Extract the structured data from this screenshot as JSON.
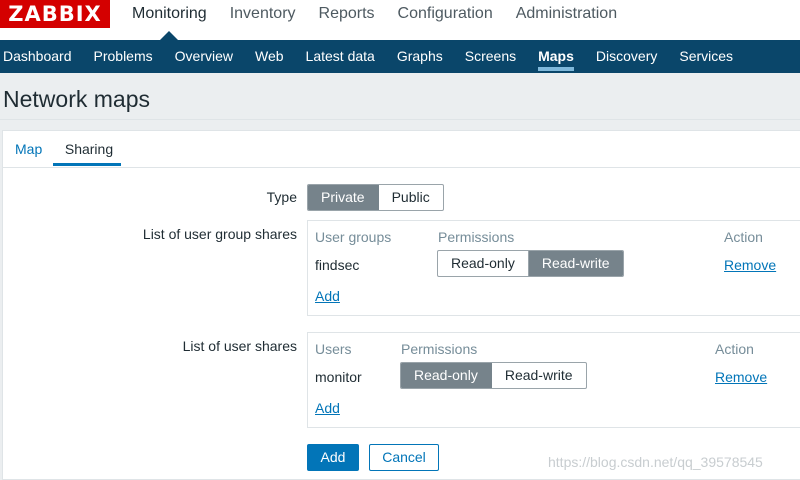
{
  "logo": "ZABBIX",
  "top_menu": [
    "Monitoring",
    "Inventory",
    "Reports",
    "Configuration",
    "Administration"
  ],
  "sub_menu": [
    "Dashboard",
    "Problems",
    "Overview",
    "Web",
    "Latest data",
    "Graphs",
    "Screens",
    "Maps",
    "Discovery",
    "Services"
  ],
  "page_title": "Network maps",
  "tabs": {
    "map": "Map",
    "sharing": "Sharing"
  },
  "type": {
    "label": "Type",
    "options": [
      "Private",
      "Public"
    ],
    "selected": "Private"
  },
  "group_shares": {
    "label": "List of user group shares",
    "headers": {
      "name": "User groups",
      "permissions": "Permissions",
      "action": "Action"
    },
    "rows": [
      {
        "name": "findsec",
        "options": [
          "Read-only",
          "Read-write"
        ],
        "selected": "Read-write",
        "action": "Remove"
      }
    ],
    "add": "Add"
  },
  "user_shares": {
    "label": "List of user shares",
    "headers": {
      "name": "Users",
      "permissions": "Permissions",
      "action": "Action"
    },
    "rows": [
      {
        "name": "monitor",
        "options": [
          "Read-only",
          "Read-write"
        ],
        "selected": "Read-only",
        "action": "Remove"
      }
    ],
    "add": "Add"
  },
  "buttons": {
    "add": "Add",
    "cancel": "Cancel"
  },
  "watermark": "https://blog.csdn.net/qq_39578545",
  "colors": {
    "brand_red": "#d40000",
    "nav_blue": "#0a466a",
    "link_blue": "#0275b8",
    "selected_gray": "#76838b"
  }
}
